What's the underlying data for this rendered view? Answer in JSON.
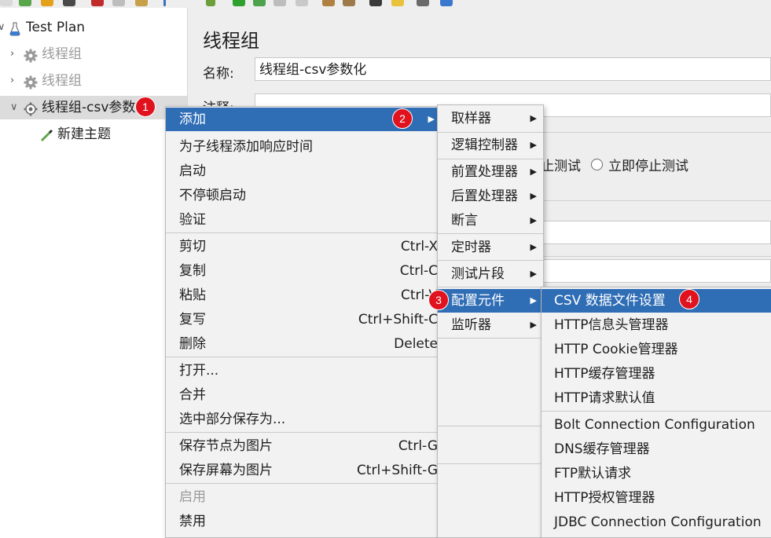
{
  "tree": {
    "items": [
      {
        "label": "Test Plan",
        "state": "expanded"
      },
      {
        "label": "线程组",
        "state": "disabled"
      },
      {
        "label": "线程组",
        "state": "disabled"
      },
      {
        "label": "线程组-csv参数化",
        "state": "selected"
      },
      {
        "label": "新建主题",
        "state": "child"
      }
    ]
  },
  "panel": {
    "title": "线程组",
    "name_label": "名称:",
    "name_value": "线程组-csv参数化",
    "comment_label": "注释:",
    "radio_stop_test_partial": "止测试",
    "radio_stop_test_now": "立即停止测试"
  },
  "context_menu": {
    "add": "添加",
    "add_think_time": "为子线程添加响应时间",
    "start": "启动",
    "start_no_pauses": "不停顿启动",
    "validate": "验证",
    "cut": "剪切",
    "cut_sc": "Ctrl-X",
    "copy": "复制",
    "copy_sc": "Ctrl-C",
    "paste": "粘贴",
    "paste_sc": "Ctrl-V",
    "duplicate": "复写",
    "duplicate_sc": "Ctrl+Shift-C",
    "delete": "删除",
    "delete_sc": "Delete",
    "open": "打开...",
    "merge": "合并",
    "save_selection": "选中部分保存为...",
    "save_node_image": "保存节点为图片",
    "save_node_image_sc": "Ctrl-G",
    "save_screen_image": "保存屏幕为图片",
    "save_screen_image_sc": "Ctrl+Shift-G",
    "enable": "启用",
    "disable": "禁用"
  },
  "add_submenu": {
    "sampler": "取样器",
    "logic_controller": "逻辑控制器",
    "pre_processors": "前置处理器",
    "post_processors": "后置处理器",
    "assertions": "断言",
    "timer": "定时器",
    "test_fragment": "测试片段",
    "config_element": "配置元件",
    "listener": "监听器"
  },
  "config_submenu": {
    "csv": "CSV 数据文件设置",
    "http_header": "HTTP信息头管理器",
    "http_cookie": "HTTP Cookie管理器",
    "http_cache": "HTTP缓存管理器",
    "http_defaults": "HTTP请求默认值",
    "bolt": "Bolt Connection Configuration",
    "dns": "DNS缓存管理器",
    "ftp": "FTP默认请求",
    "http_auth": "HTTP授权管理器",
    "jdbc": "JDBC Connection Configuration"
  },
  "badges": {
    "b1": "1",
    "b2": "2",
    "b3": "3",
    "b4": "4"
  },
  "colors": {
    "highlight": "#2f6db5",
    "badge": "#e0121e",
    "menu_bg": "#f2f2f2"
  }
}
